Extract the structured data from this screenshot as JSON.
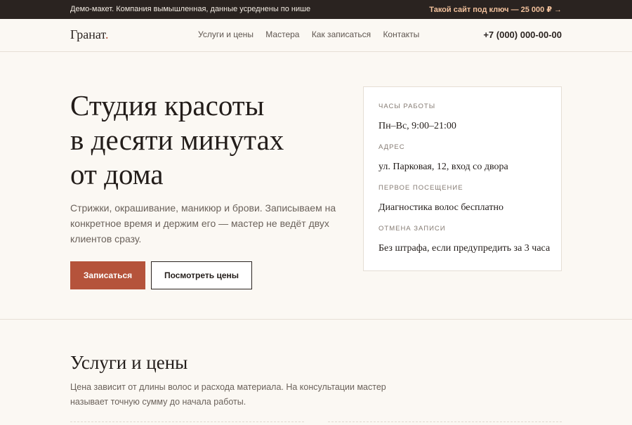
{
  "topbar": {
    "note": "Демо-макет. Компания вымышленная, данные усреднены по нише",
    "offer": "Такой сайт под ключ — 25 000 ₽",
    "offer_arrow": "→"
  },
  "header": {
    "logo": "Гранат",
    "logo_dot": ".",
    "nav": [
      "Услуги и цены",
      "Мастера",
      "Как записаться",
      "Контакты"
    ],
    "phone": "+7 (000) 000-00-00"
  },
  "hero": {
    "title_lines": [
      "Студия красоты",
      "в десяти минутах",
      "от дома"
    ],
    "text": "Стрижки, окрашивание, маникюр и брови. Записываем на конкретное время и держим его — мастер не ведёт двух клиентов сразу.",
    "primary_button": "Записаться",
    "secondary_button": "Посмотреть цены"
  },
  "info": {
    "items": [
      {
        "label": "Часы работы",
        "value": "Пн–Вс, 9:00–21:00"
      },
      {
        "label": "Адрес",
        "value": "ул. Парковая, 12, вход со двора"
      },
      {
        "label": "Первое посещение",
        "value": "Диагностика волос бесплатно"
      },
      {
        "label": "Отмена записи",
        "value": "Без штрафа, если предупредить за 3 часа"
      }
    ]
  },
  "services": {
    "title": "Услуги и цены",
    "text": "Цена зависит от длины волос и расхода материала. На консультации мастер называет точную сумму до начала работы."
  },
  "colors": {
    "accent": "#b5533b",
    "topbar_bg": "#2a2320",
    "page_bg": "#fbf8f3",
    "offer": "#f2c19c"
  }
}
